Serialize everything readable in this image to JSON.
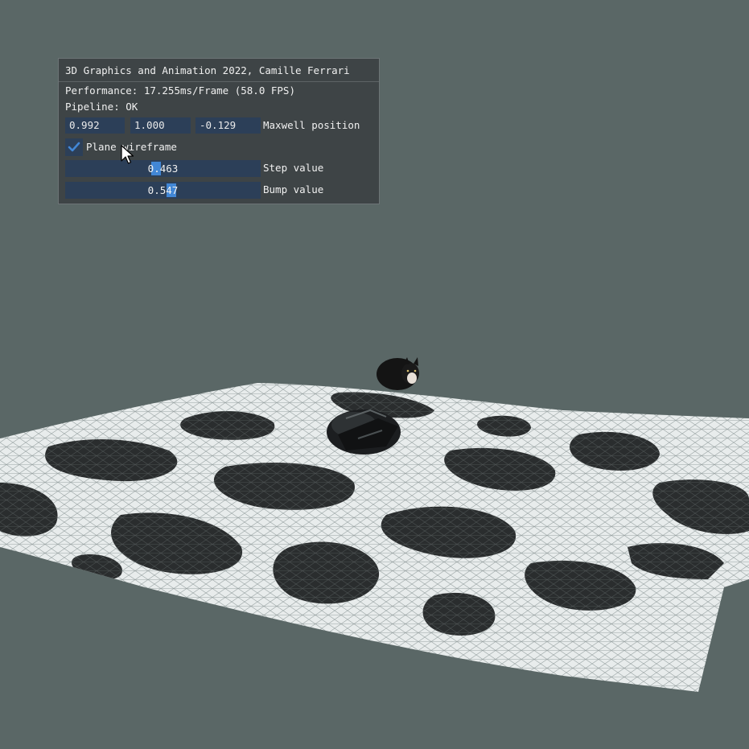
{
  "window": {
    "title": "3D Graphics and Animation 2022, Camille Ferrari",
    "performance": "Performance: 17.255ms/Frame (58.0 FPS)",
    "pipeline": "Pipeline: OK",
    "maxwell": {
      "x": "0.992",
      "y": "1.000",
      "z": "-0.129",
      "label": "Maxwell position"
    },
    "wireframe": {
      "label": "Plane wireframe",
      "checked": true
    },
    "step": {
      "value": "0.463",
      "fraction": 0.463,
      "label": "Step value"
    },
    "bump": {
      "value": "0.547",
      "fraction": 0.547,
      "label": "Bump value"
    }
  },
  "colors": {
    "background": "#5a6766",
    "panel": "#3c4244",
    "frame": "#2c3f58",
    "accent": "#4287d6",
    "wire_light": "#ffffff",
    "wire_dark": "#1a1a1a"
  },
  "icons": [
    "checkmark-icon",
    "mouse-cursor-icon"
  ]
}
